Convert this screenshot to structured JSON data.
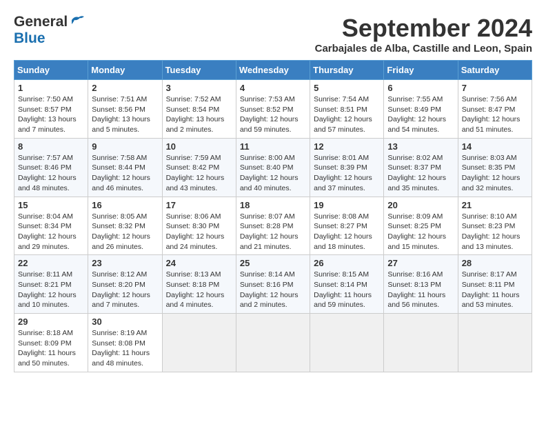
{
  "header": {
    "logo_general": "General",
    "logo_blue": "Blue",
    "month_title": "September 2024",
    "subtitle": "Carbajales de Alba, Castille and Leon, Spain"
  },
  "weekdays": [
    "Sunday",
    "Monday",
    "Tuesday",
    "Wednesday",
    "Thursday",
    "Friday",
    "Saturday"
  ],
  "weeks": [
    [
      {
        "day": "1",
        "sunrise": "7:50 AM",
        "sunset": "8:57 PM",
        "daylight": "13 hours and 7 minutes."
      },
      {
        "day": "2",
        "sunrise": "7:51 AM",
        "sunset": "8:56 PM",
        "daylight": "13 hours and 5 minutes."
      },
      {
        "day": "3",
        "sunrise": "7:52 AM",
        "sunset": "8:54 PM",
        "daylight": "13 hours and 2 minutes."
      },
      {
        "day": "4",
        "sunrise": "7:53 AM",
        "sunset": "8:52 PM",
        "daylight": "12 hours and 59 minutes."
      },
      {
        "day": "5",
        "sunrise": "7:54 AM",
        "sunset": "8:51 PM",
        "daylight": "12 hours and 57 minutes."
      },
      {
        "day": "6",
        "sunrise": "7:55 AM",
        "sunset": "8:49 PM",
        "daylight": "12 hours and 54 minutes."
      },
      {
        "day": "7",
        "sunrise": "7:56 AM",
        "sunset": "8:47 PM",
        "daylight": "12 hours and 51 minutes."
      }
    ],
    [
      {
        "day": "8",
        "sunrise": "7:57 AM",
        "sunset": "8:46 PM",
        "daylight": "12 hours and 48 minutes."
      },
      {
        "day": "9",
        "sunrise": "7:58 AM",
        "sunset": "8:44 PM",
        "daylight": "12 hours and 46 minutes."
      },
      {
        "day": "10",
        "sunrise": "7:59 AM",
        "sunset": "8:42 PM",
        "daylight": "12 hours and 43 minutes."
      },
      {
        "day": "11",
        "sunrise": "8:00 AM",
        "sunset": "8:40 PM",
        "daylight": "12 hours and 40 minutes."
      },
      {
        "day": "12",
        "sunrise": "8:01 AM",
        "sunset": "8:39 PM",
        "daylight": "12 hours and 37 minutes."
      },
      {
        "day": "13",
        "sunrise": "8:02 AM",
        "sunset": "8:37 PM",
        "daylight": "12 hours and 35 minutes."
      },
      {
        "day": "14",
        "sunrise": "8:03 AM",
        "sunset": "8:35 PM",
        "daylight": "12 hours and 32 minutes."
      }
    ],
    [
      {
        "day": "15",
        "sunrise": "8:04 AM",
        "sunset": "8:34 PM",
        "daylight": "12 hours and 29 minutes."
      },
      {
        "day": "16",
        "sunrise": "8:05 AM",
        "sunset": "8:32 PM",
        "daylight": "12 hours and 26 minutes."
      },
      {
        "day": "17",
        "sunrise": "8:06 AM",
        "sunset": "8:30 PM",
        "daylight": "12 hours and 24 minutes."
      },
      {
        "day": "18",
        "sunrise": "8:07 AM",
        "sunset": "8:28 PM",
        "daylight": "12 hours and 21 minutes."
      },
      {
        "day": "19",
        "sunrise": "8:08 AM",
        "sunset": "8:27 PM",
        "daylight": "12 hours and 18 minutes."
      },
      {
        "day": "20",
        "sunrise": "8:09 AM",
        "sunset": "8:25 PM",
        "daylight": "12 hours and 15 minutes."
      },
      {
        "day": "21",
        "sunrise": "8:10 AM",
        "sunset": "8:23 PM",
        "daylight": "12 hours and 13 minutes."
      }
    ],
    [
      {
        "day": "22",
        "sunrise": "8:11 AM",
        "sunset": "8:21 PM",
        "daylight": "12 hours and 10 minutes."
      },
      {
        "day": "23",
        "sunrise": "8:12 AM",
        "sunset": "8:20 PM",
        "daylight": "12 hours and 7 minutes."
      },
      {
        "day": "24",
        "sunrise": "8:13 AM",
        "sunset": "8:18 PM",
        "daylight": "12 hours and 4 minutes."
      },
      {
        "day": "25",
        "sunrise": "8:14 AM",
        "sunset": "8:16 PM",
        "daylight": "12 hours and 2 minutes."
      },
      {
        "day": "26",
        "sunrise": "8:15 AM",
        "sunset": "8:14 PM",
        "daylight": "11 hours and 59 minutes."
      },
      {
        "day": "27",
        "sunrise": "8:16 AM",
        "sunset": "8:13 PM",
        "daylight": "11 hours and 56 minutes."
      },
      {
        "day": "28",
        "sunrise": "8:17 AM",
        "sunset": "8:11 PM",
        "daylight": "11 hours and 53 minutes."
      }
    ],
    [
      {
        "day": "29",
        "sunrise": "8:18 AM",
        "sunset": "8:09 PM",
        "daylight": "11 hours and 50 minutes."
      },
      {
        "day": "30",
        "sunrise": "8:19 AM",
        "sunset": "8:08 PM",
        "daylight": "11 hours and 48 minutes."
      },
      null,
      null,
      null,
      null,
      null
    ]
  ]
}
